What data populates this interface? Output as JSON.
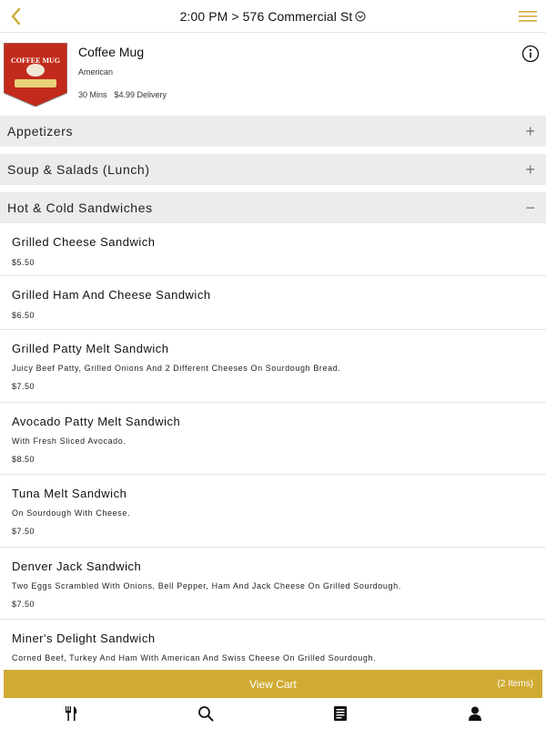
{
  "header": {
    "title": "2:00 PM > 576 Commercial St",
    "accent_color": "#d0ab34",
    "back_icon": "chevron-left-icon",
    "menu_icon": "hamburger-menu-icon"
  },
  "restaurant": {
    "name": "Coffee Mug",
    "cuisine": "American",
    "time": "30 Mins",
    "delivery_fee": "$4.99 Delivery",
    "logo_text": "COFFEE MUG"
  },
  "categories": [
    {
      "label": "Appetizers",
      "toggle": "+"
    },
    {
      "label": "Soup & Salads (Lunch)",
      "toggle": "+"
    },
    {
      "label": "Hot & Cold Sandwiches",
      "toggle": "−"
    }
  ],
  "items": [
    {
      "name": "Grilled Cheese Sandwich",
      "description": "",
      "price": "$5.50"
    },
    {
      "name": "Grilled Ham And Cheese Sandwich",
      "description": "",
      "price": "$6.50"
    },
    {
      "name": "Grilled Patty Melt Sandwich",
      "description": "Juicy Beef Patty, Grilled Onions And 2 Different Cheeses On Sourdough Bread.",
      "price": "$7.50"
    },
    {
      "name": "Avocado Patty Melt Sandwich",
      "description": "With Fresh Sliced Avocado.",
      "price": "$8.50"
    },
    {
      "name": "Tuna Melt Sandwich",
      "description": "On Sourdough With Cheese.",
      "price": "$7.50"
    },
    {
      "name": "Denver Jack Sandwich",
      "description": "Two Eggs Scrambled With Onions, Bell Pepper, Ham And Jack Cheese On Grilled Sourdough.",
      "price": "$7.50"
    },
    {
      "name": "Miner's Delight Sandwich",
      "description": "Corned Beef, Turkey And Ham With American And Swiss Cheese On Grilled Sourdough.",
      "price": ""
    }
  ],
  "cart": {
    "label": "View Cart",
    "count": "(2 Items)"
  },
  "tabbar": {
    "tabs": [
      "fork-knife-icon",
      "search-icon",
      "orders-icon",
      "profile-icon"
    ]
  }
}
